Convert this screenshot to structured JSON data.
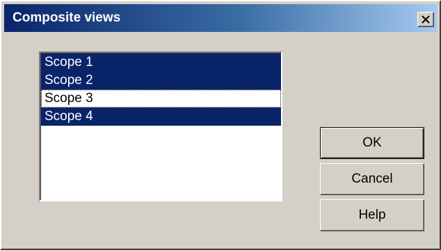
{
  "window": {
    "title": "Composite views",
    "close_symbol": "close-icon"
  },
  "listbox": {
    "items": [
      {
        "label": "Scope 1",
        "selected": true
      },
      {
        "label": "Scope 2",
        "selected": true
      },
      {
        "label": "Scope 3",
        "selected": false,
        "focused": true
      },
      {
        "label": "Scope 4",
        "selected": true
      }
    ]
  },
  "buttons": {
    "ok": "OK",
    "cancel": "Cancel",
    "help": "Help"
  },
  "colors": {
    "face": "#d4d0c8",
    "selection": "#0a246a",
    "title_start": "#0a246a",
    "title_end": "#a6caf0"
  }
}
